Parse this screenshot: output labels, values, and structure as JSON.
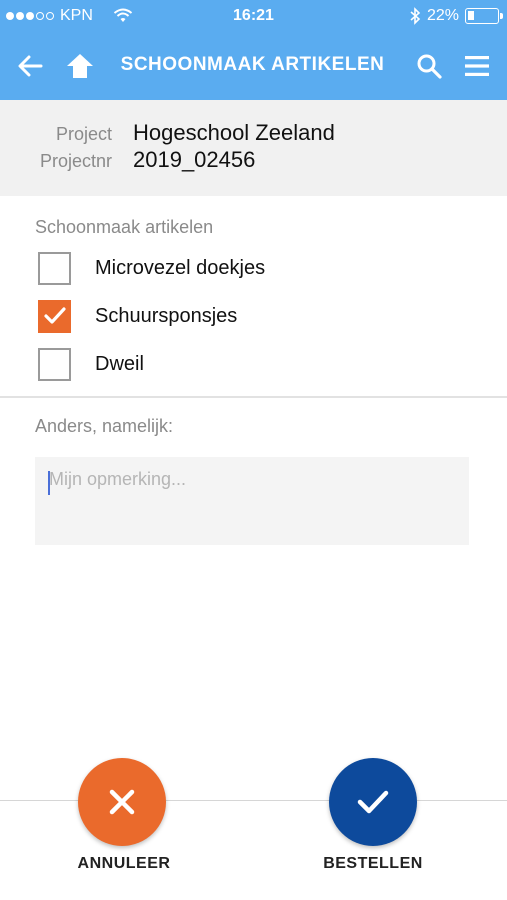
{
  "status_bar": {
    "carrier": "KPN",
    "signal_dots_filled": 3,
    "signal_dots_total": 5,
    "time": "16:21",
    "battery_percent": "22%",
    "battery_level": 0.22
  },
  "nav": {
    "title": "SCHOONMAAK ARTIKELEN",
    "icons": [
      "back-arrow-icon",
      "home-icon",
      "search-icon",
      "menu-icon"
    ]
  },
  "project": {
    "project_label": "Project",
    "project_value": "Hogeschool Zeeland",
    "projectnr_label": "Projectnr",
    "projectnr_value": "2019_02456"
  },
  "items_section": {
    "title": "Schoonmaak artikelen",
    "items": [
      {
        "label": "Microvezel doekjes",
        "checked": false
      },
      {
        "label": "Schuursponsjes",
        "checked": true
      },
      {
        "label": "Dweil",
        "checked": false
      }
    ]
  },
  "other": {
    "label": "Anders, namelijk:",
    "placeholder": "Mijn opmerking..."
  },
  "actions": {
    "cancel_label": "ANNULEER",
    "order_label": "BESTELLEN"
  },
  "colors": {
    "header_blue": "#5aacf0",
    "accent_orange": "#ea6a2c",
    "confirm_navy": "#0d4a9c"
  }
}
